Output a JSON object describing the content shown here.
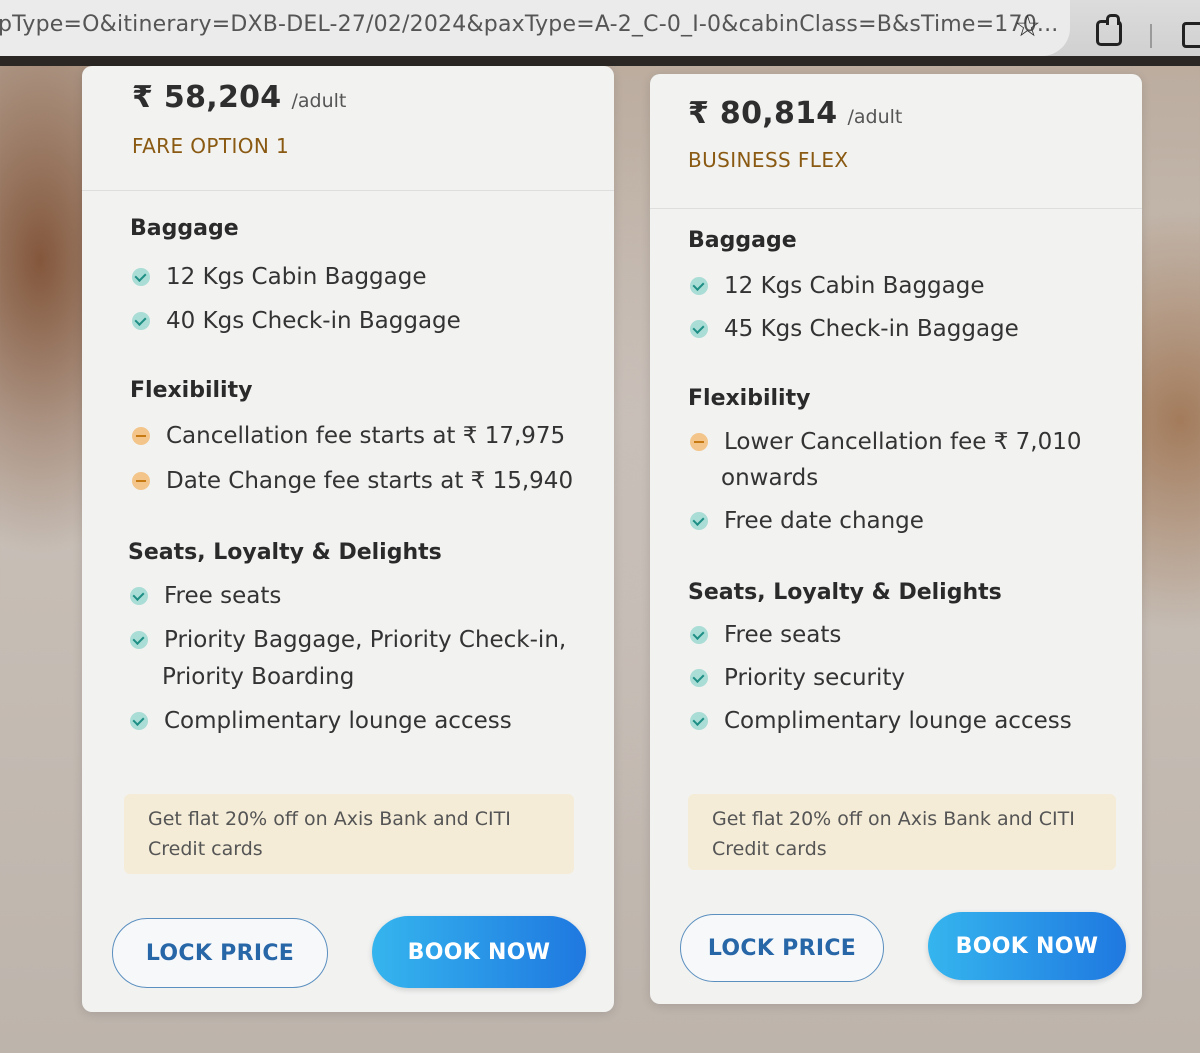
{
  "browser": {
    "url": "pType=O&itinerary=DXB-DEL-27/02/2024&paxType=A-2_C-0_I-0&cabinClass=B&sTime=170..."
  },
  "cards": [
    {
      "price": "₹ 58,204",
      "per": "/adult",
      "fare_name": "FARE OPTION 1",
      "baggage_title": "Baggage",
      "baggage": [
        "12 Kgs Cabin Baggage",
        "40 Kgs Check-in Baggage"
      ],
      "flex_title": "Flexibility",
      "flex": [
        "Cancellation fee starts at ₹ 17,975",
        "Date Change fee starts at ₹ 15,940"
      ],
      "seats_title": "Seats, Loyalty & Delights",
      "seats": [
        "Free seats",
        "Priority Baggage, Priority Check-in,",
        "Priority Boarding",
        "Complimentary lounge access"
      ],
      "offer_line1": "Get flat 20% off on Axis Bank and CITI",
      "offer_line2": "Credit cards",
      "lock_label": "LOCK PRICE",
      "book_label": "BOOK NOW"
    },
    {
      "price": "₹ 80,814",
      "per": "/adult",
      "fare_name": "BUSINESS FLEX",
      "baggage_title": "Baggage",
      "baggage": [
        "12 Kgs Cabin Baggage",
        "45 Kgs Check-in Baggage"
      ],
      "flex_title": "Flexibility",
      "flex": [
        "Lower Cancellation fee ₹ 7,010",
        "onwards",
        "Free date change"
      ],
      "seats_title": "Seats, Loyalty & Delights",
      "seats": [
        "Free seats",
        "Priority security",
        "Complimentary lounge access"
      ],
      "offer_line1": "Get flat 20% off on Axis Bank and CITI",
      "offer_line2": "Credit cards",
      "lock_label": "LOCK PRICE",
      "book_label": "BOOK NOW"
    }
  ],
  "icons": {
    "included": "check-icon",
    "fee": "minus-icon",
    "bookmark": "star-icon",
    "extensions": "puzzle-icon"
  },
  "colors": {
    "accent": "#1f78e0",
    "fare_name": "#8a5a12",
    "offer_bg": "#f4ecd7"
  }
}
